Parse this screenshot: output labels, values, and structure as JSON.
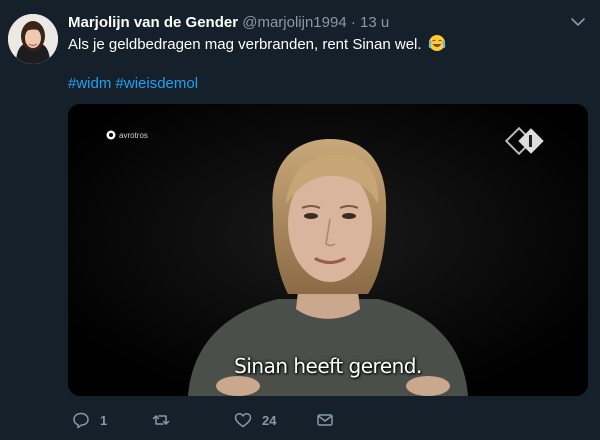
{
  "tweet": {
    "author_name": "Marjolijn van de Gender",
    "author_handle": "@marjolijn1994",
    "separator": "·",
    "time": "13 u",
    "text": "Als je geldbedragen mag verbranden, rent Sinan wel.",
    "emoji": "face-with-tears-of-joy",
    "hashtags": [
      "#widm",
      "#wieisdemol"
    ]
  },
  "media": {
    "channel_logo_text": "avrotros",
    "subtitle": "Sinan heeft gerend."
  },
  "actions": {
    "reply_count": "1",
    "retweet_count": "",
    "like_count": "24"
  },
  "colors": {
    "background": "#15202b",
    "secondary_text": "#8899a6",
    "link": "#1da1f2"
  }
}
